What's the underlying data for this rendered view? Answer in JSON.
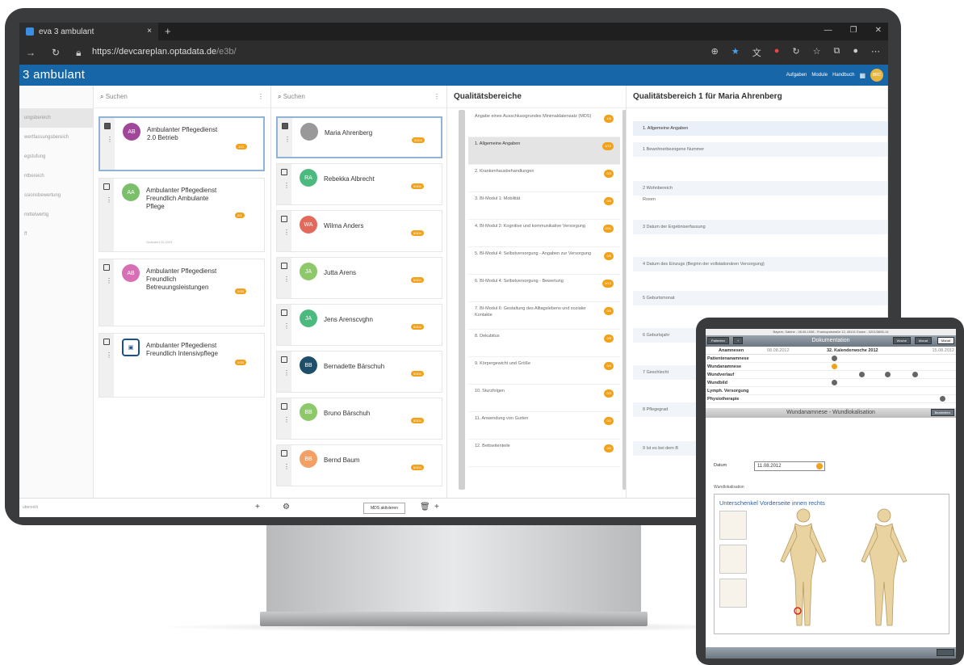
{
  "browser": {
    "tab_title": "eva 3 ambulant",
    "url_main": "https://devcareplan.optadata.de",
    "url_path": "/e3b/",
    "new_tab": "+",
    "close": "×"
  },
  "app": {
    "brand": "3 ambulant",
    "menu": [
      "Aufgaben",
      "Module",
      "Handbuch"
    ],
    "avatar": "BRC"
  },
  "sidebar": {
    "items": [
      "ungsbereich",
      "wertfassungsbereich",
      "egstufung",
      "ntbereich",
      "ssionsbewertung",
      "mittelwertig",
      "ff"
    ],
    "footer": "ubereich"
  },
  "providers": {
    "search_placeholder": "Suchen",
    "items": [
      {
        "initials": "AB",
        "name": "Ambulanter Pflegedienst 2.0 Betrieb",
        "badge": "1/11",
        "color": "#a0479a"
      },
      {
        "initials": "AA",
        "name": "Ambulanter Pflegedienst Freundlich Ambulante Pflege",
        "badge": "0/1",
        "sub": "Geändert 02.2023",
        "color": "#7bbf6a"
      },
      {
        "initials": "AB",
        "name": "Ambulanter Pflegedienst Freundlich Betreuungsleistungen",
        "badge": "0/15",
        "color": "#d86fb4"
      },
      {
        "initials": "",
        "name": "Ambulanter Pflegedienst Freundlich Intensivpflege",
        "badge": "0/15",
        "color": "#1d4f91"
      }
    ]
  },
  "patients": {
    "search_placeholder": "Suchen",
    "items": [
      {
        "initials": "",
        "name": "Maria Ahrenberg",
        "badge": "0/104",
        "color": "#999"
      },
      {
        "initials": "RA",
        "name": "Rebekka Albrecht",
        "badge": "0/104",
        "color": "#4cba7e"
      },
      {
        "initials": "WA",
        "name": "Wilma Anders",
        "badge": "0/104",
        "color": "#e26a5a"
      },
      {
        "initials": "JA",
        "name": "Jutta Arens",
        "badge": "0/104",
        "color": "#8dc86a"
      },
      {
        "initials": "JA",
        "name": "Jens Arenscvghn",
        "badge": "0/104",
        "color": "#4cba7e"
      },
      {
        "initials": "BB",
        "name": "Bernadette Bärschuh",
        "badge": "0/104",
        "color": "#1d4f6a"
      },
      {
        "initials": "BB",
        "name": "Bruno Bärschuh",
        "badge": "0/104",
        "color": "#8dc86a"
      },
      {
        "initials": "BB",
        "name": "Bernd Baum",
        "badge": "0/104",
        "color": "#f2a066"
      }
    ],
    "mds_button": "MDS aktivieren"
  },
  "quality": {
    "title": "Qualitätsbereiche",
    "items": [
      {
        "label": "Angabe eines Ausschlussgrundes Minimaldatensatz (MDS)",
        "badge": "1/6"
      },
      {
        "label": "1. Allgemeine Angaben",
        "badge": "1/10"
      },
      {
        "label": "2. Krankenhausbehandlungen",
        "badge": "0/3"
      },
      {
        "label": "3. BI-Modul 1: Mobilität",
        "badge": "0/5"
      },
      {
        "label": "4. BI-Modul 2: Kognitive und kommunikative Versorgung",
        "badge": "0/11"
      },
      {
        "label": "5. BI-Modul 4: Selbstversorgung - Angaben zur Versorgung",
        "badge": "0/5"
      },
      {
        "label": "6. BI-Modul 4: Selbstversorgung - Bewertung",
        "badge": "0/13"
      },
      {
        "label": "7. BI-Modul 6: Gestaltung des Alltagslebens und sozialer Kontakte",
        "badge": "0/6"
      },
      {
        "label": "8. Dekubitus",
        "badge": "0/5"
      },
      {
        "label": "9. Körpergewicht und Größe",
        "badge": "0/4"
      },
      {
        "label": "10. Sturzfolgen",
        "badge": "0/3"
      },
      {
        "label": "11. Anwendung von Gurten",
        "badge": "0/2"
      },
      {
        "label": "12. Bettseitenteile",
        "badge": "0/2"
      }
    ]
  },
  "detail": {
    "title": "Qualitätsbereich 1 für Maria Ahrenberg",
    "section": "1. Allgemeine Angaben",
    "rows": [
      "1  Bewohnerbezogene Nummer",
      "2  Wohnbereich",
      "Rosen",
      "3  Datum der Ergebniserfassung",
      "4  Datum des Einzugs (Beginn der vollstationären Versorgung)",
      "5  Geburtsmonat",
      "6  Geburtsjahr",
      "7  Geschlecht",
      "8  Pflegegrad",
      "9  Ist es bei dem B"
    ]
  },
  "tablet": {
    "patient_line": "Bayern, Sabine - 08.06.1938 - Frankopalstraße 12, 45141 Essen - 0201/3655-14",
    "header": "Dokumentation",
    "tabs": [
      "Woche",
      "Monat",
      "Monat"
    ],
    "back": "Patienten",
    "timeline_title": "Anamnesen",
    "date_from": "08.08.2012",
    "week": "32. Kalenderwoche 2012",
    "date_to": "15.08.2012",
    "rows": [
      "Patientenanamnese",
      "Wundanamnese",
      "Wundverlauf",
      "Wundbild",
      "Lymph. Versorgung",
      "Physiotherapie"
    ],
    "section": "Wundanamnese - Wundlokalisation",
    "section_btn": "Bearbeiten",
    "date_label": "Datum",
    "date_value": "11.08.2012",
    "loc_label": "Wundlokalisation",
    "location": "Unterschenkel Vorderseite innen rechts"
  }
}
